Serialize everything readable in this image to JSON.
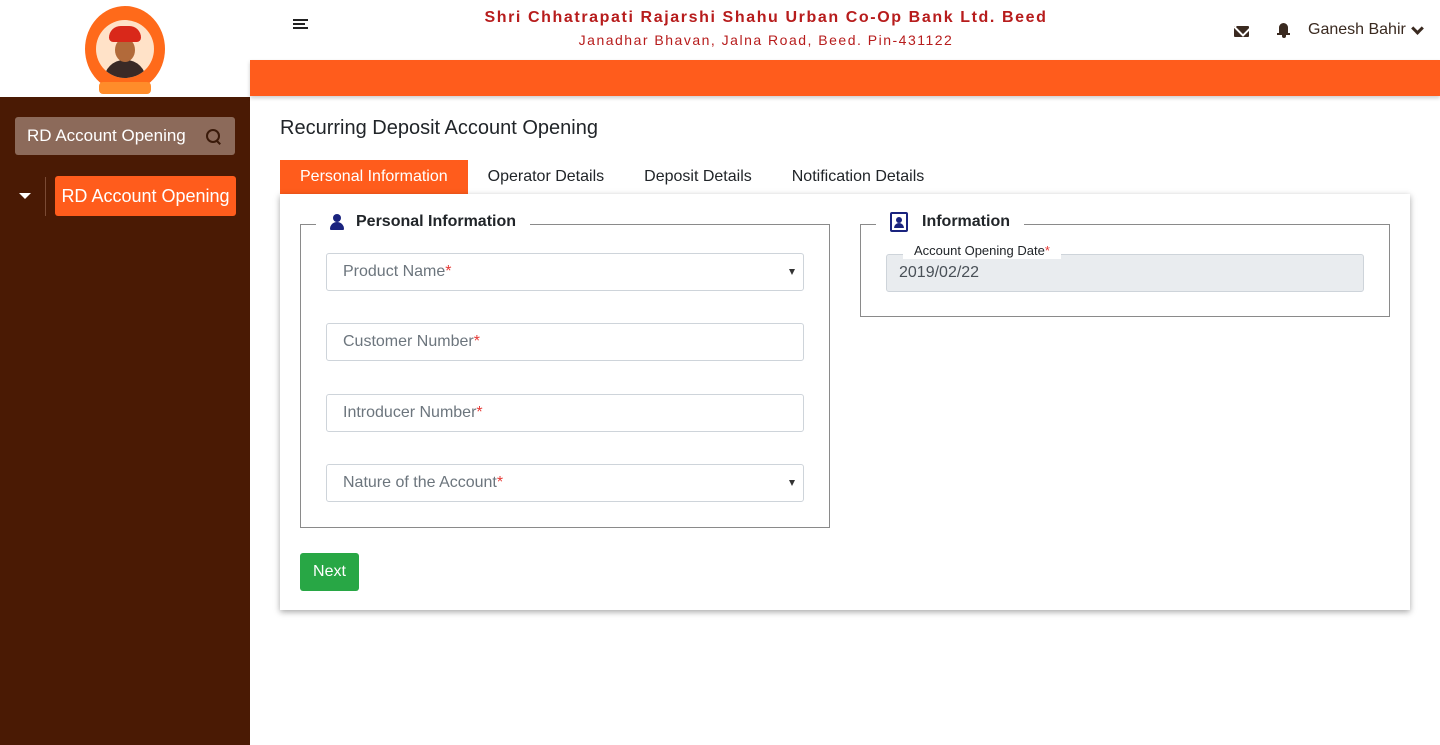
{
  "header": {
    "bank_name": "Shri Chhatrapati Rajarshi Shahu Urban Co-Op Bank Ltd. Beed",
    "bank_address": "Janadhar Bhavan, Jalna Road, Beed. Pin-431122",
    "user_name": "Ganesh Bahir",
    "icons": [
      "menu-icon",
      "mail-icon",
      "bell-icon",
      "chevron-down-icon"
    ]
  },
  "colors": {
    "accent": "#ff5c1c",
    "sidebar_bg": "#4a1a04",
    "title_red": "#b71c1c",
    "next_button": "#28a745"
  },
  "sidebar": {
    "search_label": "RD Account Opening",
    "items": [
      {
        "label": "RD Account Opening"
      }
    ]
  },
  "main": {
    "page_title": "Recurring Deposit Account Opening",
    "tabs": [
      {
        "label": "Personal Information",
        "active": true
      },
      {
        "label": "Operator Details",
        "active": false
      },
      {
        "label": "Deposit Details",
        "active": false
      },
      {
        "label": "Notification Details",
        "active": false
      }
    ],
    "personal_section": {
      "legend": "Personal Information",
      "fields": {
        "product_name": {
          "placeholder": "Product Name",
          "required_mark": "*"
        },
        "customer_number": {
          "placeholder": "Customer Number",
          "required_mark": "*"
        },
        "introducer_number": {
          "placeholder": "Introducer Number",
          "required_mark": "*"
        },
        "nature_of_account": {
          "placeholder": "Nature of the Account",
          "required_mark": "*"
        }
      }
    },
    "info_section": {
      "legend": "Information",
      "account_opening_date": {
        "label": "Account Opening Date",
        "required_mark": "*",
        "value": "2019/02/22"
      }
    },
    "next_label": "Next"
  }
}
